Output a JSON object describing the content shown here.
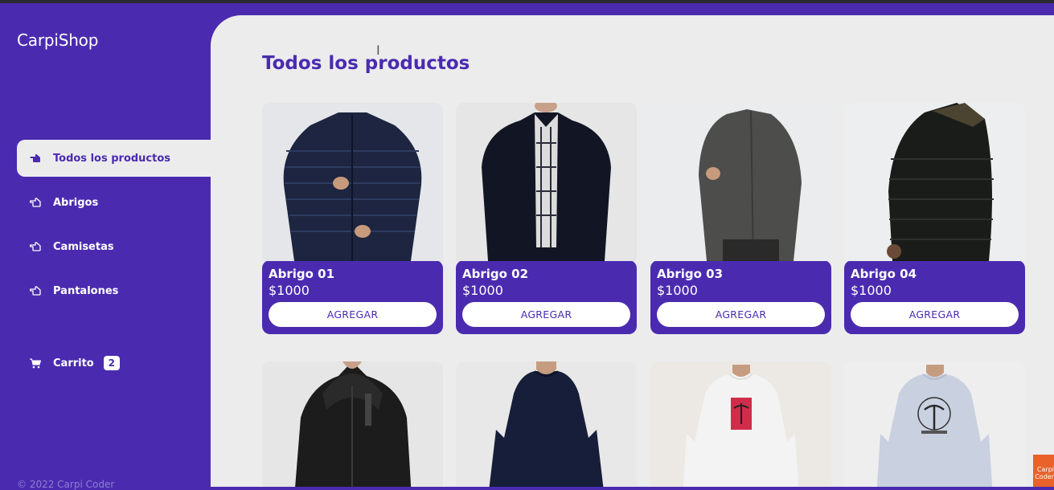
{
  "app": {
    "name": "CarpiShop"
  },
  "sidebar": {
    "items": [
      {
        "label": "Todos los productos",
        "icon": "hand-pointer-icon",
        "active": true
      },
      {
        "label": "Abrigos",
        "icon": "hand-pointer-outline-icon",
        "active": false
      },
      {
        "label": "Camisetas",
        "icon": "hand-pointer-outline-icon",
        "active": false
      },
      {
        "label": "Pantalones",
        "icon": "hand-pointer-outline-icon",
        "active": false
      }
    ],
    "cart": {
      "label": "Carrito",
      "count": "2",
      "icon": "cart-icon"
    },
    "footer": "© 2022 Carpi Coder"
  },
  "main": {
    "title": "Todos los productos",
    "products": [
      {
        "name": "Abrigo 01",
        "price": "$1000",
        "button": "AGREGAR"
      },
      {
        "name": "Abrigo 02",
        "price": "$1000",
        "button": "AGREGAR"
      },
      {
        "name": "Abrigo 03",
        "price": "$1000",
        "button": "AGREGAR"
      },
      {
        "name": "Abrigo 04",
        "price": "$1000",
        "button": "AGREGAR"
      }
    ]
  },
  "watermark": {
    "text": "Carpi Coder"
  },
  "colors": {
    "accent": "#4a2bb0",
    "background": "#ececec"
  }
}
